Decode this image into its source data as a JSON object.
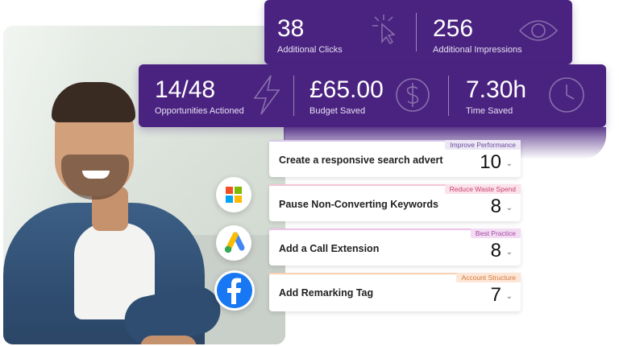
{
  "top_card": {
    "metrics": [
      {
        "value": "38",
        "label": "Additional Clicks",
        "icon": "cursor-click-icon"
      },
      {
        "value": "256",
        "label": "Additional Impressions",
        "icon": "eye-icon"
      }
    ]
  },
  "mid_card": {
    "metrics": [
      {
        "value": "14/48",
        "label": "Opportunities Actioned",
        "icon": "lightning-icon"
      },
      {
        "value": "£65.00",
        "label": "Budget Saved",
        "icon": "dollar-circle-icon"
      },
      {
        "value": "7.30h",
        "label": "Time Saved",
        "icon": "clock-icon"
      }
    ]
  },
  "actions": [
    {
      "title": "Create a responsive search advert",
      "tag": "Improve Performance",
      "count": "10",
      "tag_bg": "#ece6f5",
      "tag_fg": "#6a4c9c",
      "strip": "#d7c8ee"
    },
    {
      "title": "Pause Non-Converting Keywords",
      "tag": "Reduce Waste Spend",
      "count": "8",
      "tag_bg": "#fbe1ea",
      "tag_fg": "#c8446e",
      "strip": "#f6c5d5"
    },
    {
      "title": "Add a Call Extension",
      "tag": "Best Practice",
      "count": "8",
      "tag_bg": "#f3dcf3",
      "tag_fg": "#a34aa3",
      "strip": "#eac4ea"
    },
    {
      "title": "Add Remarking Tag",
      "tag": "Account Structure",
      "count": "7",
      "tag_bg": "#fde6d6",
      "tag_fg": "#d27a3c",
      "strip": "#f9d2b5"
    }
  ],
  "platforms": [
    {
      "name": "microsoft-logo"
    },
    {
      "name": "google-ads-logo"
    },
    {
      "name": "facebook-logo"
    }
  ],
  "colors": {
    "brand_purple": "#4a2380"
  }
}
